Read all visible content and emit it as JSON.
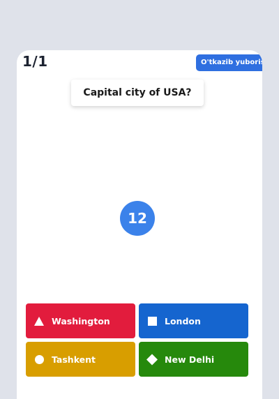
{
  "quiz": {
    "counter": "1/1",
    "skip_label": "O'tkazib yuborish",
    "question": "Capital city of USA?",
    "timer": "12"
  },
  "answers": [
    {
      "label": "Washington",
      "shape": "triangle-icon",
      "color": "#e21c3d"
    },
    {
      "label": "London",
      "shape": "square-icon",
      "color": "#1565cf"
    },
    {
      "label": "Tashkent",
      "shape": "circle-icon",
      "color": "#d89e00"
    },
    {
      "label": "New Delhi",
      "shape": "diamond-icon",
      "color": "#26890c"
    }
  ],
  "colors": {
    "background": "#dfe2ea",
    "skip_button": "#2f6fe0",
    "timer": "#3b82ea"
  }
}
